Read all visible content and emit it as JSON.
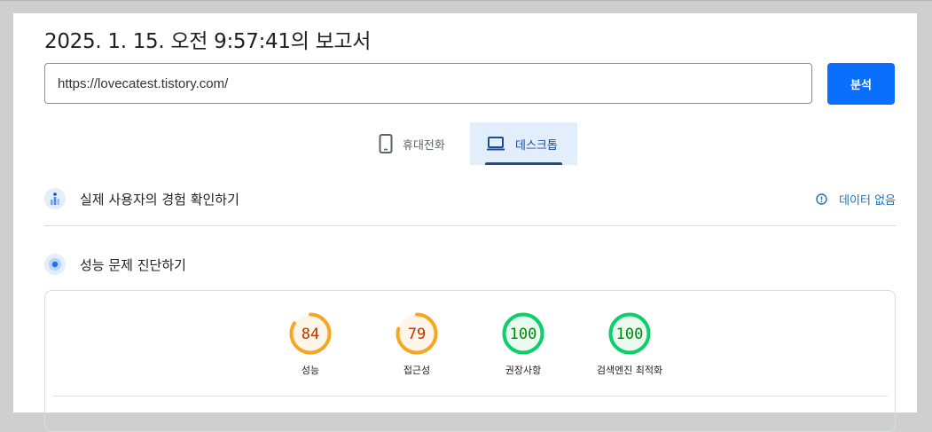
{
  "report": {
    "title": "2025. 1. 15. 오전 9:57:41의 보고서"
  },
  "search": {
    "url": "https://lovecatest.tistory.com/",
    "analyze_label": "분석"
  },
  "device_tabs": [
    {
      "label": "휴대전화",
      "icon": "smartphone-icon",
      "selected": false
    },
    {
      "label": "데스크톱",
      "icon": "laptop-icon",
      "selected": true
    }
  ],
  "field_data": {
    "label": "실제 사용자의 경험 확인하기",
    "status": "데이터 없음",
    "icon": "users-chart-icon"
  },
  "diagnostics": {
    "label": "성능 문제 진단하기",
    "icon": "lighthouse-icon"
  },
  "scores": [
    {
      "label": "성능",
      "value": 84,
      "color": "#f5a623",
      "fill": "#fff6ea",
      "text_color": "#c33300"
    },
    {
      "label": "접근성",
      "value": 79,
      "color": "#f5a623",
      "fill": "#fff6ea",
      "text_color": "#c33300"
    },
    {
      "label": "권장사항",
      "value": 100,
      "color": "#0cce6b",
      "fill": "#eafaf1",
      "text_color": "#008800"
    },
    {
      "label": "검색엔진 최적화",
      "value": 100,
      "color": "#0cce6b",
      "fill": "#eafaf1",
      "text_color": "#008800"
    }
  ]
}
